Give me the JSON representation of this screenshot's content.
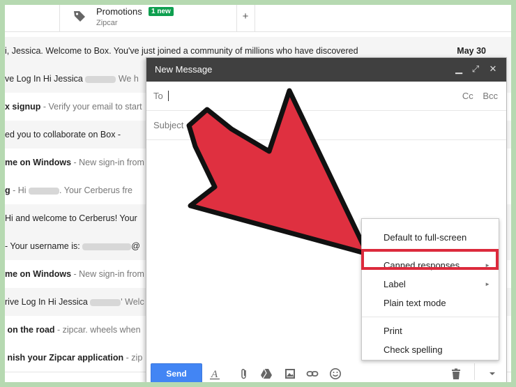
{
  "tabs": {
    "promotions": {
      "title": "Promotions",
      "badge": "1 new",
      "subtitle": "Zipcar"
    },
    "add": "+"
  },
  "emails": [
    {
      "subject": "i, Jessica. Welcome to Box. You've just joined a community of millions who have discovered",
      "snippet": "",
      "date": "May 30",
      "unread": false
    },
    {
      "subject": "ve Log In Hi Jessica",
      "snippet": "We h",
      "date": "",
      "unread": false
    },
    {
      "subject": "x signup",
      "snippet": " - Verify your email to start",
      "date": "",
      "unread": true
    },
    {
      "subject": "ed you to collaborate on Box -",
      "snippet": "",
      "date": "",
      "unread": false
    },
    {
      "subject": "me on Windows",
      "snippet": " - New sign-in from",
      "date": "",
      "unread": true
    },
    {
      "subject": "g",
      "snippet": " - Hi",
      "snippet2": ". Your Cerberus fre",
      "date": "",
      "unread": true
    },
    {
      "subject": "Hi and welcome to Cerberus! Your",
      "snippet": "",
      "date": "",
      "unread": false
    },
    {
      "subject": " - Your username is:",
      "snippet": "@",
      "date": "",
      "unread": false
    },
    {
      "subject": "me on Windows",
      "snippet": " - New sign-in from",
      "date": "",
      "unread": true
    },
    {
      "subject": "rive Log In Hi Jessica",
      "snippet": "' Welc",
      "date": "",
      "unread": false
    },
    {
      "subject": "on the road",
      "snippet": " - zipcar. wheels when",
      "date": "",
      "unread": true
    },
    {
      "subject": "nish your Zipcar application",
      "snippet": " - zip",
      "date": "",
      "unread": true
    }
  ],
  "compose": {
    "title": "New Message",
    "to_label": "To",
    "cc": "Cc",
    "bcc": "Bcc",
    "subject_label": "Subject",
    "send_label": "Send"
  },
  "menu": {
    "items": [
      "Default to full-screen",
      "Canned responses",
      "Label",
      "Plain text mode",
      "Print",
      "Check spelling"
    ]
  },
  "colors": {
    "accent_red": "#dc2a3c",
    "send_blue": "#4285f4",
    "header_dark": "#404040",
    "badge_green": "#0e9f4f"
  }
}
